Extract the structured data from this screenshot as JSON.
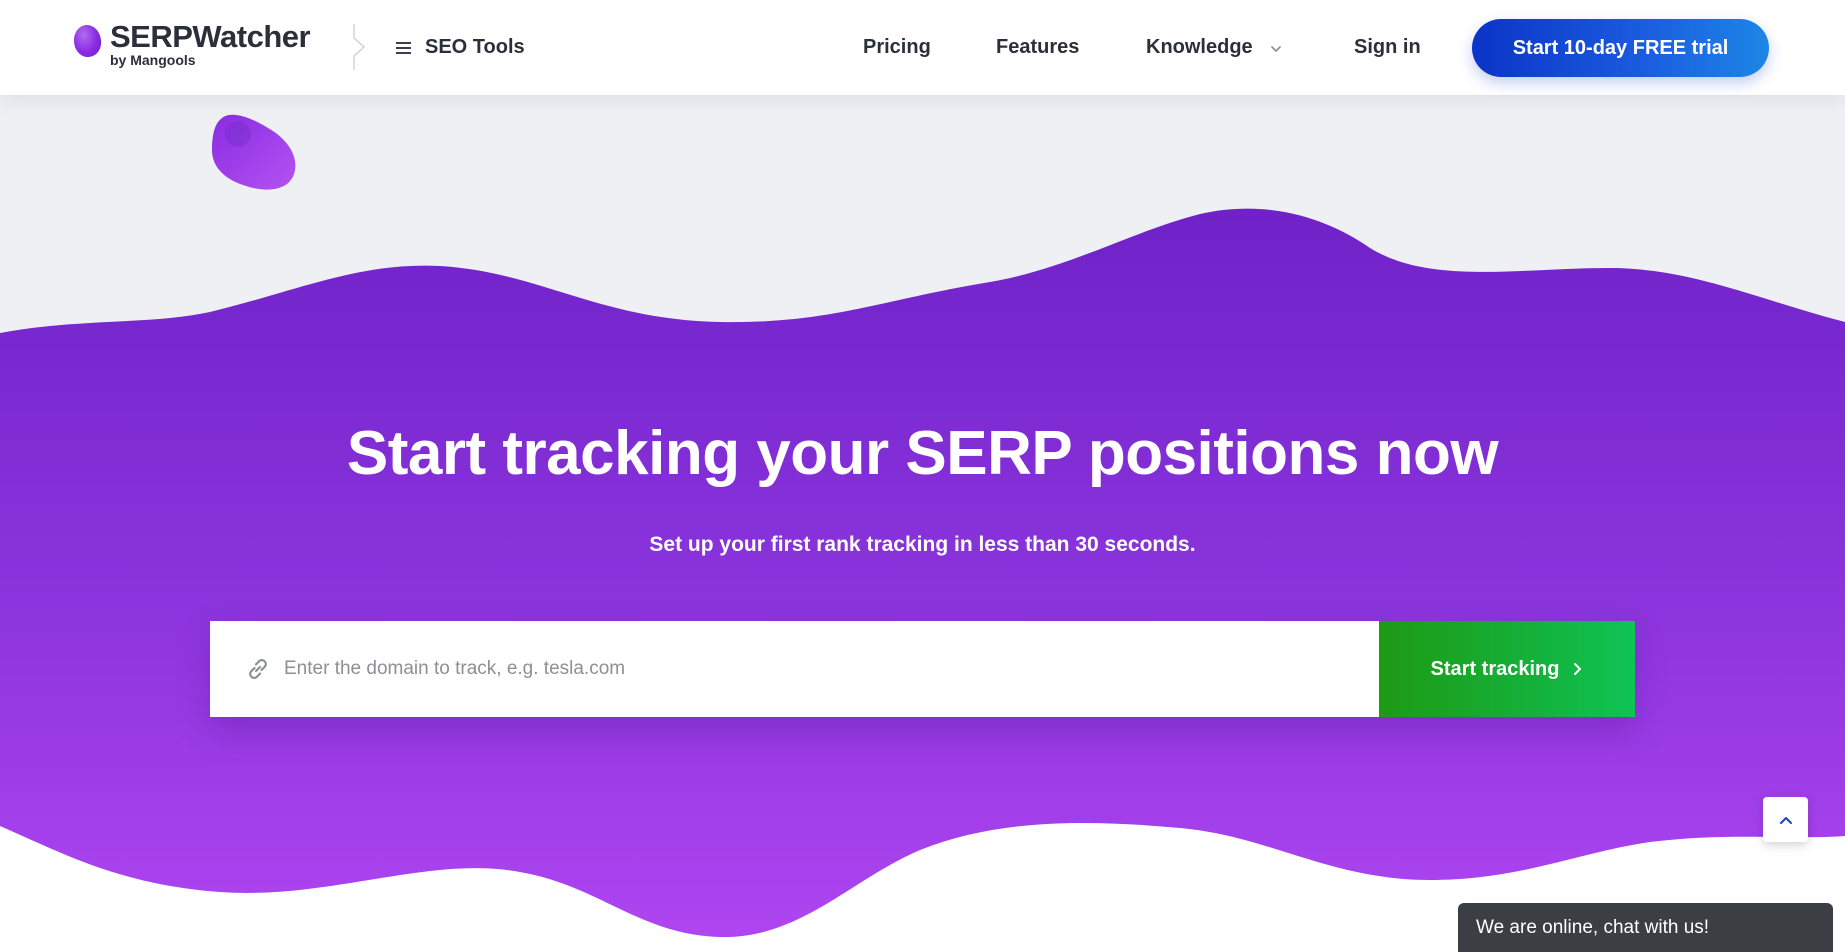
{
  "header": {
    "logo_name": "SERPWatcher",
    "logo_sub": "by Mangools",
    "seo_tools_label": "SEO Tools",
    "nav": {
      "pricing": "Pricing",
      "features": "Features",
      "knowledge": "Knowledge",
      "signin": "Sign in"
    },
    "cta_label": "Start 10-day FREE trial"
  },
  "hero": {
    "title": "Start tracking your SERP positions now",
    "subtitle": "Set up your first rank tracking in less than 30 seconds.",
    "search": {
      "placeholder": "Enter the domain to track, e.g. tesla.com",
      "value": "",
      "button_label": "Start tracking"
    }
  },
  "chat": {
    "label": "We are online, chat with us!"
  },
  "icons": {
    "logo": "purple-blob-logo",
    "menu": "hamburger-icon",
    "dropdown": "chevron-down-icon",
    "link": "link-icon",
    "button_arrow": "chevron-right-icon",
    "scroll_top": "chevron-up-icon"
  },
  "colors": {
    "brand_purple": "#7a22d0",
    "cta_blue": "#0b34c7",
    "button_green": "#14b13a",
    "text_dark": "#2b2f3a",
    "chat_bg": "#3b3e43"
  }
}
